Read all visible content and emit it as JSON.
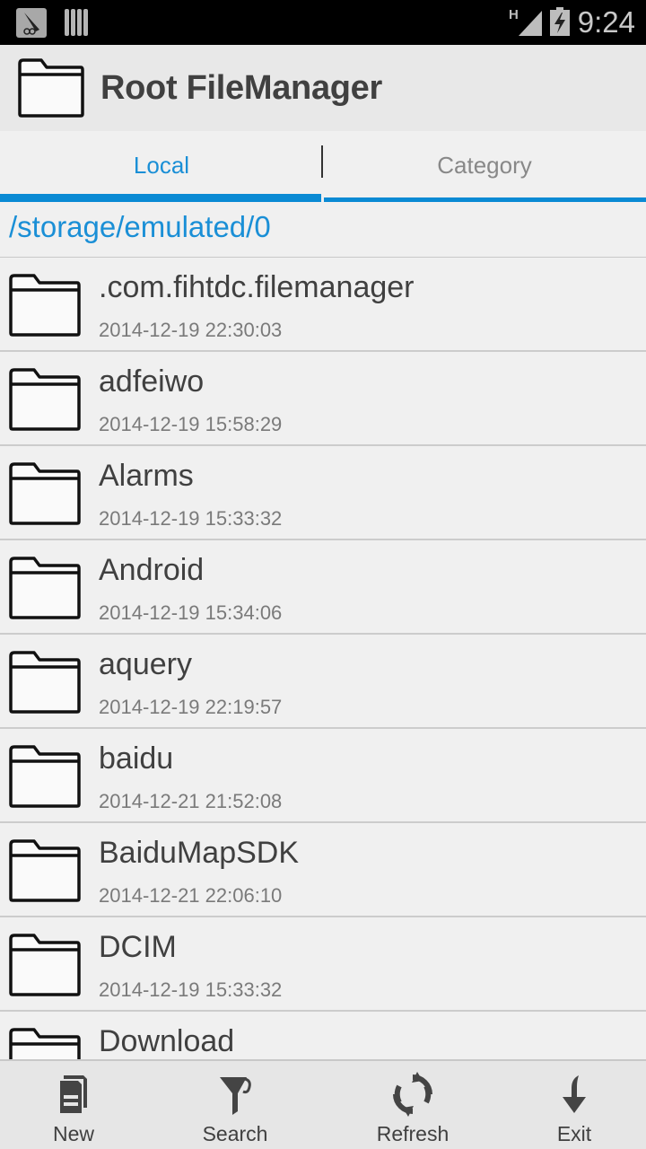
{
  "status_bar": {
    "network_type": "H",
    "time": "9:24",
    "icons": [
      "app-notification-icon",
      "sim-card-icon",
      "signal-icon",
      "battery-charging-icon"
    ]
  },
  "app": {
    "title": "Root FileManager",
    "icon": "folder-icon"
  },
  "tabs": [
    {
      "label": "Local",
      "active": true
    },
    {
      "label": "Category",
      "active": false
    }
  ],
  "path": "/storage/emulated/0",
  "files": [
    {
      "name": ".com.fihtdc.filemanager",
      "date": "2014-12-19 22:30:03",
      "type": "folder"
    },
    {
      "name": "adfeiwo",
      "date": "2014-12-19 15:58:29",
      "type": "folder"
    },
    {
      "name": "Alarms",
      "date": "2014-12-19 15:33:32",
      "type": "folder"
    },
    {
      "name": "Android",
      "date": "2014-12-19 15:34:06",
      "type": "folder"
    },
    {
      "name": "aquery",
      "date": "2014-12-19 22:19:57",
      "type": "folder"
    },
    {
      "name": "baidu",
      "date": "2014-12-21 21:52:08",
      "type": "folder"
    },
    {
      "name": "BaiduMapSDK",
      "date": "2014-12-21 22:06:10",
      "type": "folder"
    },
    {
      "name": "DCIM",
      "date": "2014-12-19 15:33:32",
      "type": "folder"
    },
    {
      "name": "Download",
      "date": "",
      "type": "folder"
    }
  ],
  "bottom_bar": {
    "new_label": "New",
    "search_label": "Search",
    "refresh_label": "Refresh",
    "exit_label": "Exit"
  },
  "colors": {
    "accent": "#0a8ad4",
    "text_primary": "#404040",
    "text_secondary": "#7a7a7a",
    "background": "#f0f0f0"
  }
}
